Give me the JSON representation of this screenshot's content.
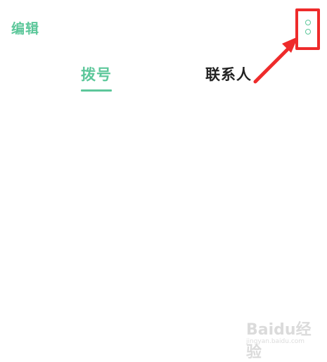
{
  "header": {
    "edit_label": "编辑",
    "more_icon": "more-vertical-icon"
  },
  "tabs": [
    {
      "label": "拨号",
      "active": true
    },
    {
      "label": "联系人",
      "active": false
    }
  ],
  "watermark": {
    "logo_text": "Baidu经验",
    "url": "jingyan.baidu.com"
  },
  "colors": {
    "accent": "#5cc79a",
    "annotation": "#ee2b2b",
    "text": "#222222"
  }
}
